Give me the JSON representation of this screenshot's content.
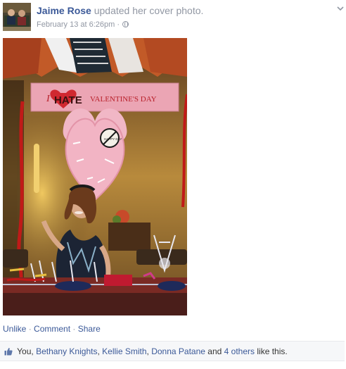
{
  "post": {
    "author": "Jaime Rose",
    "action_text": "updated her cover photo.",
    "timestamp": "February 13 at 6:26pm",
    "separator": "·",
    "privacy_icon": "globe-icon",
    "menu_icon": "chevron-down-icon",
    "photo": {
      "banner_text_1": "I",
      "banner_text_2": "HATE",
      "banner_text_3": "VALENTINE'S DAY",
      "sign_text": "HAPPY DAY"
    }
  },
  "actions": {
    "unlike": "Unlike",
    "comment": "Comment",
    "share": "Share",
    "dot": "·"
  },
  "likes": {
    "icon": "thumbs-up-icon",
    "prefix": "You,",
    "people": [
      "Bethany Knights",
      "Kellie Smith",
      "Donna Patane"
    ],
    "and_text": "and",
    "others": "4 others",
    "suffix": "like this."
  },
  "colors": {
    "link": "#3b5998",
    "muted": "#9197a3",
    "likes_bg": "#f6f7f9"
  }
}
